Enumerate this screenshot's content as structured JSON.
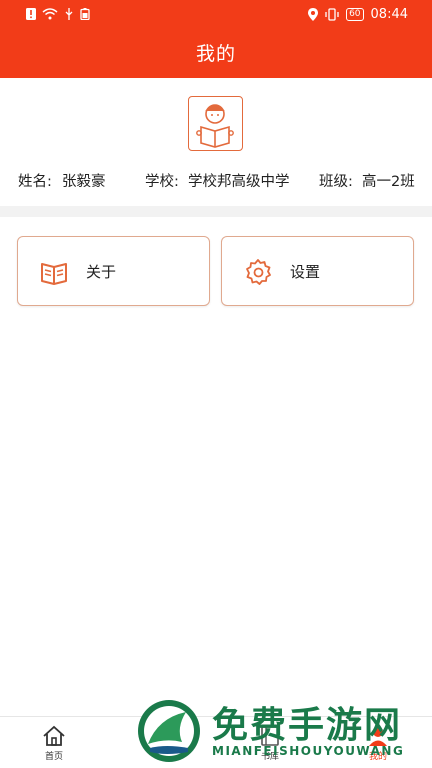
{
  "status_bar": {
    "time": "08:44",
    "battery": "60",
    "color": "#f23c18"
  },
  "header": {
    "title": "我的"
  },
  "profile": {
    "name_label": "姓名:",
    "name_value": "张毅豪",
    "school_label": "学校:",
    "school_value": "学校邦高级中学",
    "class_label": "班级:",
    "class_value": "高一2班",
    "avatar_icon": "boy-reading-icon"
  },
  "cards": [
    {
      "label": "关于",
      "icon": "book-icon"
    },
    {
      "label": "设置",
      "icon": "gear-icon"
    }
  ],
  "tabbar": {
    "tabs": [
      {
        "label": "首页",
        "icon": "home-icon"
      },
      {
        "label": "书库",
        "icon": "book-icon"
      },
      {
        "label": "我的",
        "icon": "user-icon",
        "active": true
      }
    ]
  },
  "watermark": {
    "title": "免费手游网",
    "subtitle": "MIANFEISHOUYOUWANG"
  },
  "accent_color": "#e36a3c"
}
